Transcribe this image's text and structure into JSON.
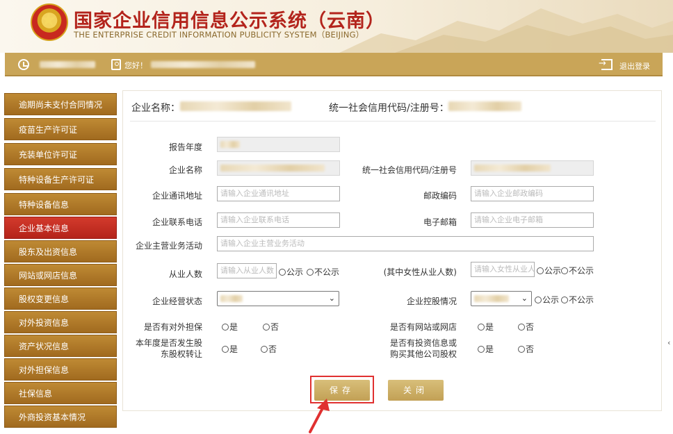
{
  "header": {
    "title": "国家企业信用信息公示系统（云南）",
    "subtitle": "THE ENTERPRISE CREDIT INFORMATION PUBLICITY SYSTEM（BEIJING）"
  },
  "topbar": {
    "greeting": "您好！",
    "logout_label": "退出登录"
  },
  "sidebar": {
    "items": [
      {
        "label": "逾期尚未支付合同情况"
      },
      {
        "label": "疫苗生产许可证"
      },
      {
        "label": "充装单位许可证"
      },
      {
        "label": "特种设备生产许可证"
      },
      {
        "label": "特种设备信息"
      },
      {
        "label": "企业基本信息"
      },
      {
        "label": "股东及出资信息"
      },
      {
        "label": "网站或网店信息"
      },
      {
        "label": "股权变更信息"
      },
      {
        "label": "对外投资信息"
      },
      {
        "label": "资产状况信息"
      },
      {
        "label": "对外担保信息"
      },
      {
        "label": "社保信息"
      },
      {
        "label": "外商投资基本情况"
      }
    ],
    "active_index": 5
  },
  "main": {
    "company_name_label": "企业名称：",
    "credit_code_label": "统一社会信用代码/注册号：",
    "form": {
      "report_year_label": "报告年度",
      "company_name_label": "企业名称",
      "credit_code_label": "统一社会信用代码/注册号",
      "address_label": "企业通讯地址",
      "address_placeholder": "请输入企业通讯地址",
      "postcode_label": "邮政编码",
      "postcode_placeholder": "请输入企业邮政编码",
      "phone_label": "企业联系电话",
      "phone_placeholder": "请输入企业联系电话",
      "email_label": "电子邮箱",
      "email_placeholder": "请输入企业电子邮箱",
      "business_label": "企业主营业务活动",
      "business_placeholder": "请输入企业主营业务活动",
      "employees_label": "从业人数",
      "employees_placeholder": "请输入从业人数",
      "female_label": "(其中女性从业人数)",
      "female_placeholder": "请输入女性从业人数",
      "status_label": "企业经营状态",
      "control_label": "企业控股情况",
      "guarantee_label": "是否有对外担保",
      "website_label": "是否有网站或网店",
      "equity_transfer_label_1": "本年度是否发生股",
      "equity_transfer_label_2": "东股权转让",
      "investment_label_1": "是否有投资信息或",
      "investment_label_2": "购买其他公司股权",
      "public_label": "公示",
      "not_public_label": "不公示",
      "yes_label": "是",
      "no_label": "否"
    },
    "save_label": "保存",
    "close_label": "关闭"
  },
  "colors": {
    "gold": "#c9a558",
    "sidebar_brown": "#a16a1f",
    "active_red": "#c62f24",
    "title_red": "#b3241c",
    "highlight_red": "#e03030"
  }
}
